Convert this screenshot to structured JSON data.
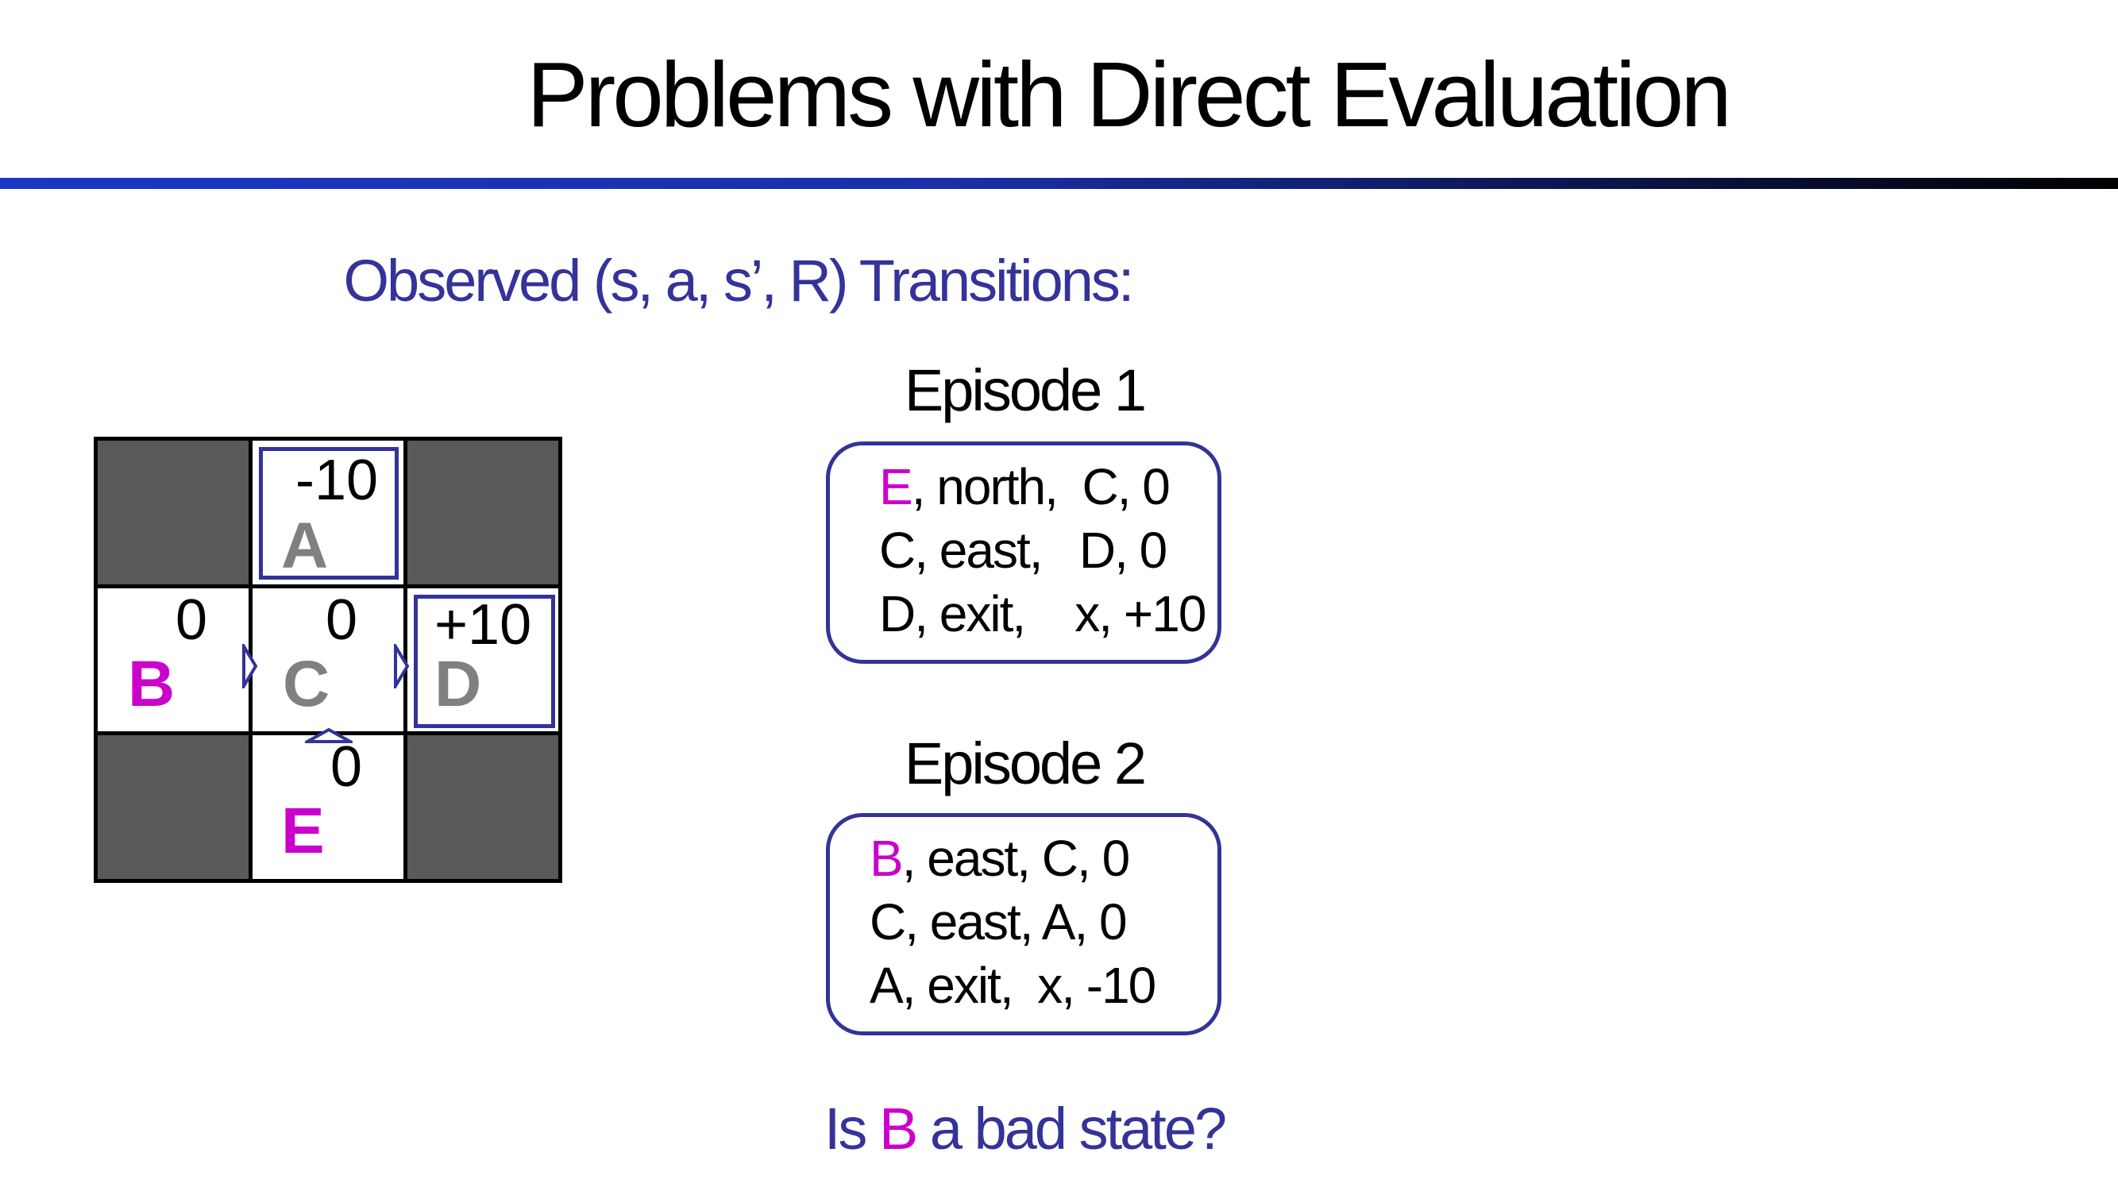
{
  "title": "Problems with Direct Evaluation",
  "subtitle": "Observed (s, a, s’, R) Transitions:",
  "grid": {
    "A": {
      "label": "A",
      "reward": "-10"
    },
    "B": {
      "label": "B",
      "reward": "0"
    },
    "C": {
      "label": "C",
      "reward": "0"
    },
    "D": {
      "label": "D",
      "reward": "+10"
    },
    "E": {
      "label": "E",
      "reward": "0"
    }
  },
  "episodes": [
    {
      "title": "Episode 1",
      "lines": [
        {
          "state": "E",
          "rest": ", north,  C, 0"
        },
        {
          "state": "C",
          "rest": ", east,   D, 0"
        },
        {
          "state": "D",
          "rest": ", exit,    x, +10"
        }
      ]
    },
    {
      "title": "Episode 2",
      "lines": [
        {
          "state": "B",
          "rest": ", east, C, 0"
        },
        {
          "state": "C",
          "rest": ", east, A, 0"
        },
        {
          "state": "A",
          "rest": ", exit,  x, -10"
        }
      ]
    }
  ],
  "question": {
    "prefix": "Is ",
    "state": "B",
    "suffix": " a bad state?"
  },
  "colors": {
    "accent": "#333399",
    "highlight": "#cc00cc",
    "wall": "#595959",
    "state_gray": "#808080"
  }
}
